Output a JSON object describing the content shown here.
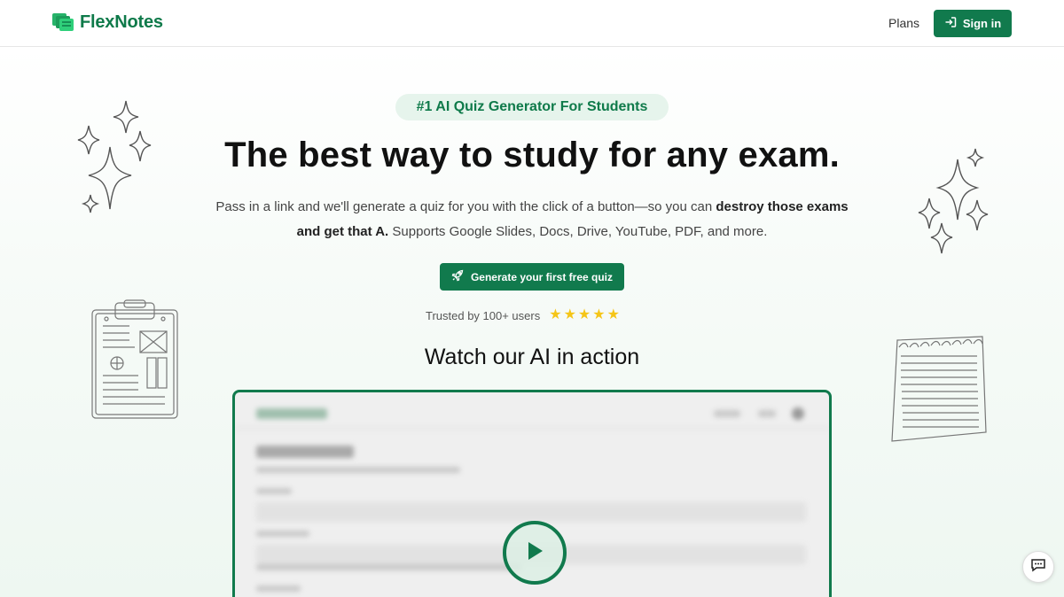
{
  "header": {
    "logo_text": "FlexNotes",
    "plans_label": "Plans",
    "signin_label": "Sign in"
  },
  "hero": {
    "badge": "#1 AI Quiz Generator For Students",
    "headline": "The best way to study for any exam.",
    "sub_part1": "Pass in a link and we'll generate a quiz for you with the click of a button—so you can ",
    "sub_bold": "destroy those exams and get that A.",
    "sub_part2": " Supports Google Slides, Docs, Drive, YouTube, PDF, and more.",
    "cta_label": "Generate your first free quiz",
    "trusted_text": "Trusted by 100+ users",
    "rating_stars": 5,
    "watch_title": "Watch our AI in action"
  },
  "icons": {
    "logo": "stacked-notes-icon",
    "signin": "sign-in-icon",
    "cta": "rocket-icon",
    "star": "star-icon",
    "play": "play-icon",
    "chat": "chat-icon"
  },
  "colors": {
    "brand": "#117a4d",
    "brand_text": "#0f7a4a",
    "badge_bg": "#e6f4ec",
    "star": "#f5c518"
  }
}
